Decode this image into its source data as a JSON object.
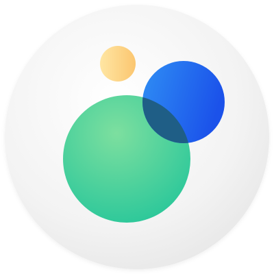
{
  "icon": {
    "name": "overlapping-circles-app-icon",
    "colors": {
      "background_disc_light": "#FFFFFF",
      "background_disc_mid": "#F3F3F3",
      "background_disc_dark": "#E8E8E8",
      "yellow_light": "#FFE6A3",
      "yellow_dark": "#FBC670",
      "green_light": "#7DDF9F",
      "green_dark": "#2AC79A",
      "blue_light": "#2F8EF4",
      "blue_dark": "#1B52EA",
      "overlap": "#1F5E86"
    }
  }
}
